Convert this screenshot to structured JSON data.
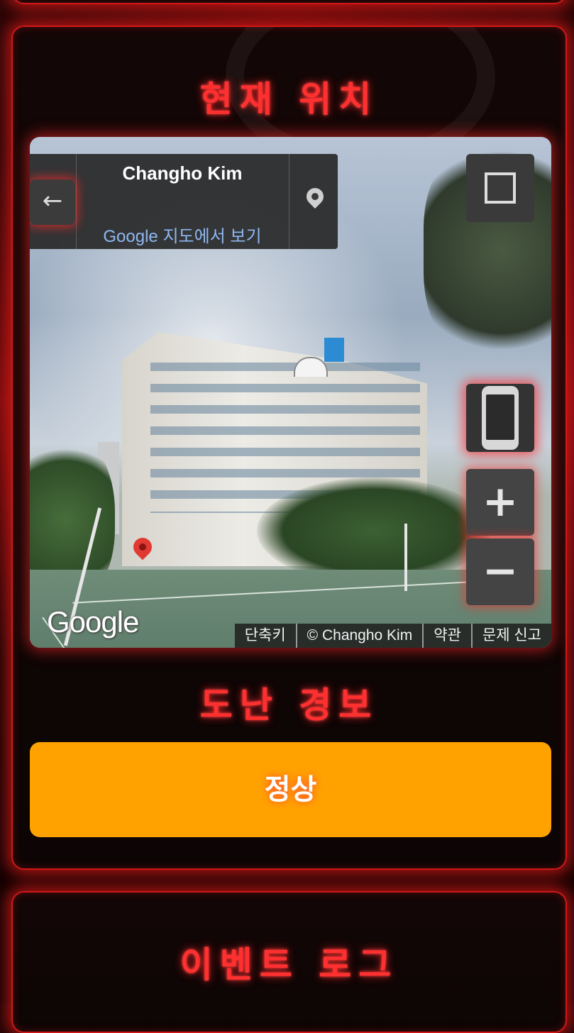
{
  "location_panel": {
    "title": "현재 위치",
    "street_view": {
      "place_name": "Changho Kim",
      "maps_link": "Google 지도에서 보기",
      "google_logo": "Google",
      "footer_links": [
        "단축키",
        "© Changho Kim",
        "약관",
        "문제 신고"
      ],
      "zoom_in_label": "+",
      "zoom_out_label": "−",
      "back_label": "←"
    }
  },
  "theft_alarm": {
    "title": "도난 경보",
    "status_label": "정상",
    "status_color": "#ffa200"
  },
  "event_log": {
    "title": "이벤트 로그"
  }
}
